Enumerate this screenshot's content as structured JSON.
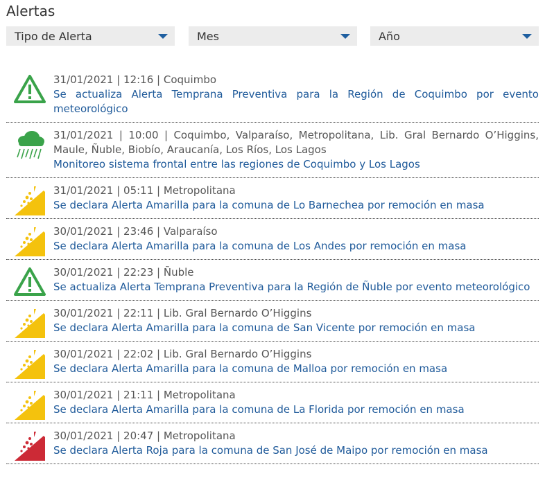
{
  "title": "Alertas",
  "filters": {
    "tipo": "Tipo de Alerta",
    "mes": "Mes",
    "anio": "Año"
  },
  "alerts": [
    {
      "icon": "warning-triangle-icon",
      "meta": "31/01/2021 | 12:16 | Coquimbo",
      "text": "Se actualiza Alerta Temprana Preventiva para la Región de Coquimbo por evento meteorológico"
    },
    {
      "icon": "rain-cloud-icon",
      "meta": "31/01/2021 | 10:00 | Coquimbo, Valparaíso, Metropolitana, Lib. Gral Bernardo O’Higgins, Maule, Ñuble, Biobío, Araucanía, Los Ríos, Los Lagos",
      "text": "Monitoreo sistema frontal entre las regiones de Coquimbo y Los Lagos"
    },
    {
      "icon": "landslide-yellow-icon",
      "meta": "31/01/2021 | 05:11 | Metropolitana",
      "text": "Se declara Alerta Amarilla para la comuna de Lo Barnechea por remoción en masa"
    },
    {
      "icon": "landslide-yellow-icon",
      "meta": "30/01/2021 | 23:46 | Valparaíso",
      "text": "Se declara Alerta Amarilla para la comuna de Los Andes por remoción en masa"
    },
    {
      "icon": "warning-triangle-icon",
      "meta": "30/01/2021 | 22:23 | Ñuble",
      "text": "Se actualiza Alerta Temprana Preventiva para la Región de Ñuble por evento meteorológico"
    },
    {
      "icon": "landslide-yellow-icon",
      "meta": "30/01/2021 | 22:11 | Lib. Gral Bernardo O’Higgins",
      "text": "Se declara Alerta Amarilla para la comuna de San Vicente por remoción en masa"
    },
    {
      "icon": "landslide-yellow-icon",
      "meta": "30/01/2021 | 22:02 | Lib. Gral Bernardo O’Higgins",
      "text": "Se declara Alerta Amarilla para la comuna de Malloa por remoción en masa"
    },
    {
      "icon": "landslide-yellow-icon",
      "meta": "30/01/2021 | 21:11 | Metropolitana",
      "text": "Se declara Alerta Amarilla para la comuna de La Florida por remoción en masa"
    },
    {
      "icon": "landslide-red-icon",
      "meta": "30/01/2021 | 20:47 | Metropolitana",
      "text": "Se declara Alerta Roja para la comuna de San José de Maipo por remoción en masa"
    }
  ],
  "colors": {
    "link": "#1f5a9a",
    "green": "#3aa34a",
    "yellow": "#f4c20d",
    "red": "#cc2a36",
    "caret": "#1f5fa0"
  }
}
